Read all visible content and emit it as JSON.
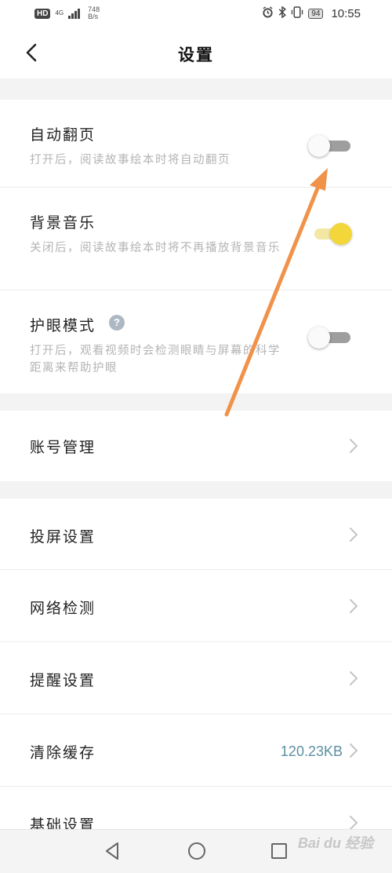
{
  "status_bar": {
    "hd": "HD",
    "network_top": "4G",
    "network_bottom": "",
    "speed_value": "748",
    "speed_unit": "B/s",
    "battery": "94",
    "time": "10:55",
    "icons": [
      "alarm-icon",
      "bluetooth-icon",
      "vibrate-icon",
      "battery-icon"
    ]
  },
  "header": {
    "title": "设置",
    "back_icon": "chevron-left-icon"
  },
  "toggles": [
    {
      "label": "自动翻页",
      "description": "打开后，阅读故事绘本时将自动翻页",
      "state": "off"
    },
    {
      "label": "背景音乐",
      "description": "关闭后，阅读故事绘本时将不再播放背景音乐",
      "state": "on"
    },
    {
      "label": "护眼模式",
      "description": "打开后，观看视频时会检测眼睛与屏幕的科学距离来帮助护眼",
      "state": "off",
      "help_icon": "?"
    }
  ],
  "account": {
    "label": "账号管理"
  },
  "menu": [
    {
      "label": "投屏设置",
      "value": ""
    },
    {
      "label": "网络检测",
      "value": ""
    },
    {
      "label": "提醒设置",
      "value": ""
    },
    {
      "label": "清除缓存",
      "value": "120.23KB"
    },
    {
      "label": "基础设置",
      "value": ""
    }
  ],
  "watermark": "Bai du 经验",
  "colors": {
    "toggle_on": "#f2d63a",
    "toggle_off_track": "#9e9e9e",
    "value_text": "#5c8fa0",
    "annotation_arrow": "#f0924a"
  }
}
